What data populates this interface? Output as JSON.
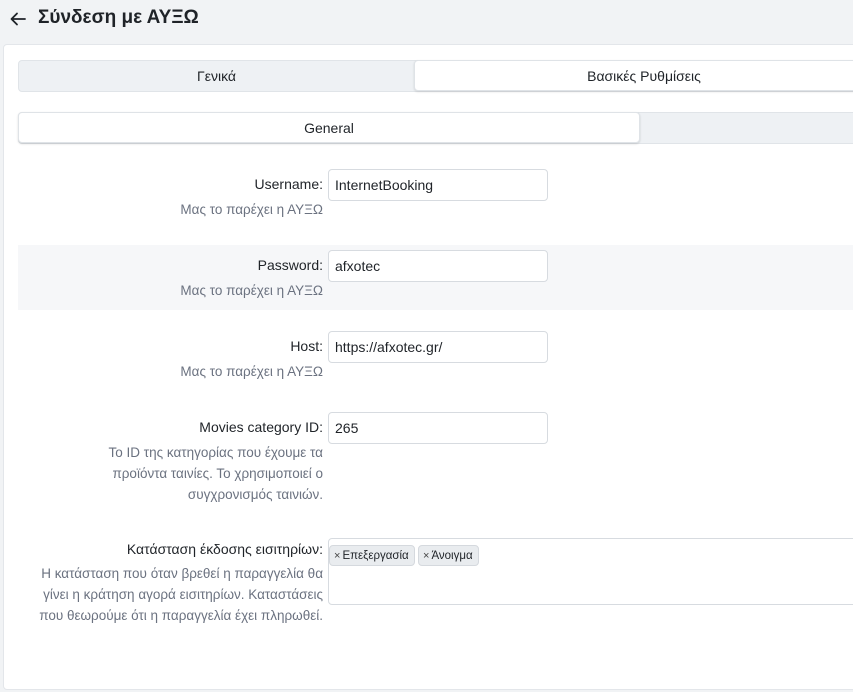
{
  "header": {
    "title": "Σύνδεση με ΑΥΞΩ",
    "back_icon": "arrow-left-icon"
  },
  "tabs_main": [
    {
      "label": "Γενικά"
    },
    {
      "label": "Βασικές Ρυθμίσεις",
      "active": true
    }
  ],
  "tabs_sub": [
    {
      "label": "General",
      "active": true
    }
  ],
  "fields": {
    "username": {
      "label": "Username:",
      "help": "Μας το παρέχει η ΑΥΞΩ",
      "value": "InternetBooking"
    },
    "password": {
      "label": "Password:",
      "help": "Μας το παρέχει η ΑΥΞΩ",
      "value": "afxotec"
    },
    "host": {
      "label": "Host:",
      "help": "Μας το παρέχει η ΑΥΞΩ",
      "value": "https://afxotec.gr/"
    },
    "movies_category": {
      "label": "Movies category ID:",
      "help": "Το ID της κατηγορίας που έχουμε τα προϊόντα ταινίες. Το χρησιμοποιεί ο συγχρονισμός ταινιών.",
      "value": "265"
    },
    "ticket_status": {
      "label": "Κατάσταση έκδοσης εισιτηρίων:",
      "help": "Η κατάσταση που όταν βρεθεί η παραγγελία θα γίνει η κράτηση αγορά εισιτηρίων. Καταστάσεις που θεωρούμε ότι η παραγγελία έχει πληρωθεί.",
      "chips": [
        {
          "label": "Επεξεργασία",
          "remove": "×"
        },
        {
          "label": "Άνοιγμα",
          "remove": "×"
        }
      ]
    }
  }
}
